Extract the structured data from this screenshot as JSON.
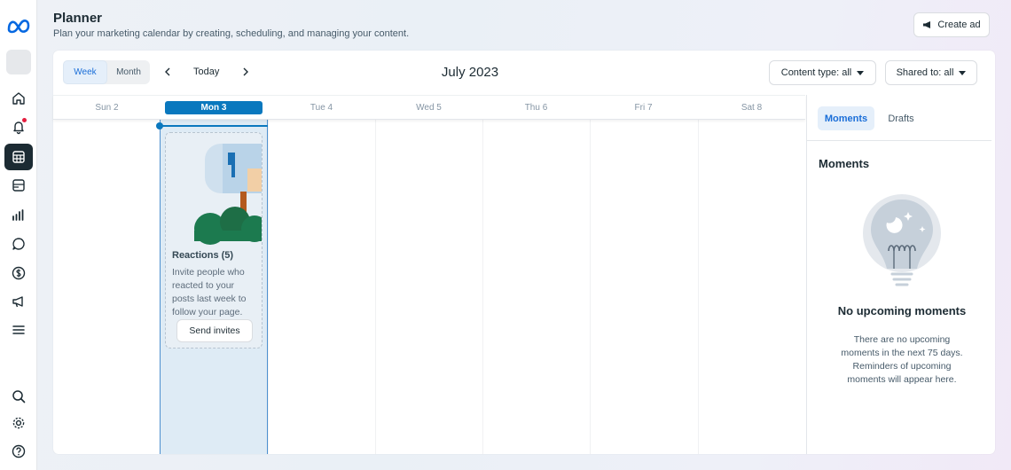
{
  "header": {
    "title": "Planner",
    "subtitle": "Plan your marketing calendar by creating, scheduling, and managing your content.",
    "create_ad_label": "Create ad"
  },
  "sidebar": {
    "items": [
      {
        "icon": "home-icon"
      },
      {
        "icon": "notifications-icon",
        "has_badge": true
      },
      {
        "icon": "planner-icon",
        "active": true
      },
      {
        "icon": "content-icon"
      },
      {
        "icon": "insights-icon"
      },
      {
        "icon": "inbox-icon"
      },
      {
        "icon": "monetization-icon"
      },
      {
        "icon": "ads-icon"
      },
      {
        "icon": "menu-icon"
      }
    ],
    "bottom_items": [
      {
        "icon": "search-icon"
      },
      {
        "icon": "settings-icon"
      },
      {
        "icon": "help-icon"
      }
    ]
  },
  "toolbar": {
    "view_week": "Week",
    "view_month": "Month",
    "selected_view": "Week",
    "today_label": "Today",
    "month_title": "July 2023",
    "content_type_label": "Content type: all",
    "shared_to_label": "Shared to: all"
  },
  "calendar": {
    "days": [
      "Sun 2",
      "Mon 3",
      "Tue 4",
      "Wed 5",
      "Thu 6",
      "Fri 7",
      "Sat 8"
    ],
    "today": "Mon 3",
    "moment_card": {
      "title": "Reactions (5)",
      "body": "Invite people who reacted to your posts last week to follow your page.",
      "button_label": "Send invites"
    }
  },
  "panel": {
    "tab_moments": "Moments",
    "tab_drafts": "Drafts",
    "active_tab": "Moments",
    "heading": "Moments",
    "empty_title": "No upcoming moments",
    "empty_text": "There are no upcoming moments in the next 75 days. Reminders of upcoming moments will appear here."
  },
  "colors": {
    "accent": "#0a78be",
    "active_tab_text": "#1a6ed8",
    "today_column": "#deebf5",
    "text_primary": "#1c2b33"
  }
}
